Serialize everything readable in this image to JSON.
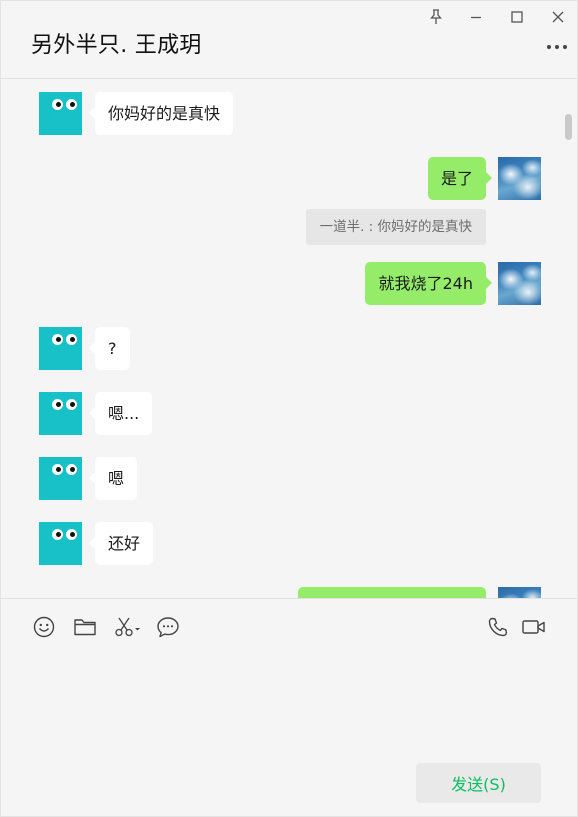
{
  "chat": {
    "title": "另外半只. 王成玥"
  },
  "messages": [
    {
      "side": "in",
      "text": "你妈好的是真快"
    },
    {
      "side": "out",
      "text": "是了"
    },
    {
      "side": "quote",
      "text": "一道半. : 你妈好的是真快"
    },
    {
      "side": "out",
      "text": "就我烧了24h"
    },
    {
      "side": "in",
      "text": "?"
    },
    {
      "side": "in",
      "text": "嗯..."
    },
    {
      "side": "in",
      "text": "嗯"
    },
    {
      "side": "in",
      "text": "还好"
    },
    {
      "side": "out",
      "text": ""
    }
  ],
  "icons": {
    "pin": "pin-icon",
    "minimize": "minimize-icon",
    "maximize": "maximize-icon",
    "close": "close-icon",
    "more": "more-icon",
    "emoji": "emoji-icon",
    "folder": "folder-icon",
    "scissors": "scissors-icon",
    "chat_history": "chat-history-icon",
    "phone": "phone-icon",
    "video": "video-icon"
  },
  "colors": {
    "bubble_out": "#95ec69",
    "bubble_in": "#ffffff",
    "avatar_teal": "#18c0c8",
    "send_text": "#07c160",
    "background": "#f5f5f5"
  },
  "composer": {
    "send_label": "发送(S)"
  }
}
